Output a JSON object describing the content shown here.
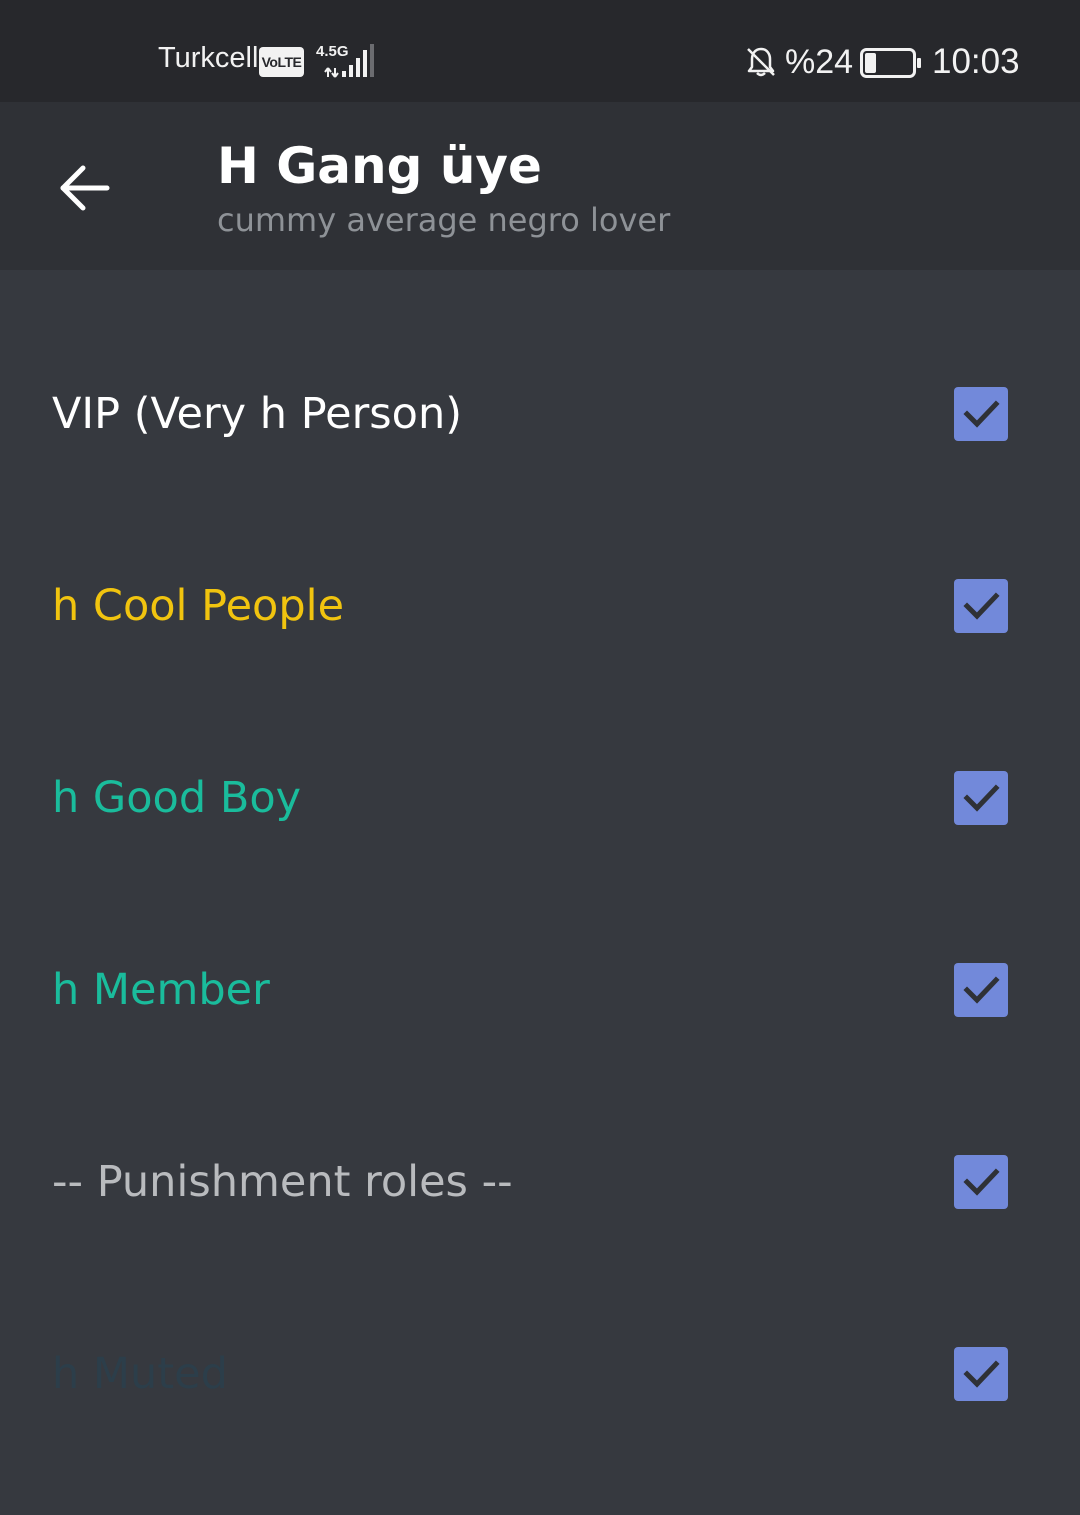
{
  "status_bar": {
    "carrier": "Turkcell",
    "volte": "VoLTE",
    "network": "4.5G",
    "battery_percent": "%24",
    "battery_level": 0.24,
    "time": "10:03"
  },
  "header": {
    "title": "H Gang üye",
    "subtitle": "cummy average negro lover",
    "back_icon": "arrow-left-icon"
  },
  "roles": [
    {
      "name": "VIP (Very h Person)",
      "color": "#ffffff",
      "checked": true
    },
    {
      "name": "h Cool People",
      "color": "#f1c40f",
      "checked": true
    },
    {
      "name": "h Good Boy",
      "color": "#1abc9c",
      "checked": true
    },
    {
      "name": "h Member",
      "color": "#1abc9c",
      "checked": true
    },
    {
      "name": "-- Punishment roles --",
      "color": "#b9bbbe",
      "checked": true
    },
    {
      "name": "h Muted",
      "color": "#2c3e4a",
      "checked": true
    }
  ],
  "colors": {
    "background": "#36393f",
    "header": "#2f3136",
    "status_bar": "#27282c",
    "checkbox": "#7289da"
  }
}
